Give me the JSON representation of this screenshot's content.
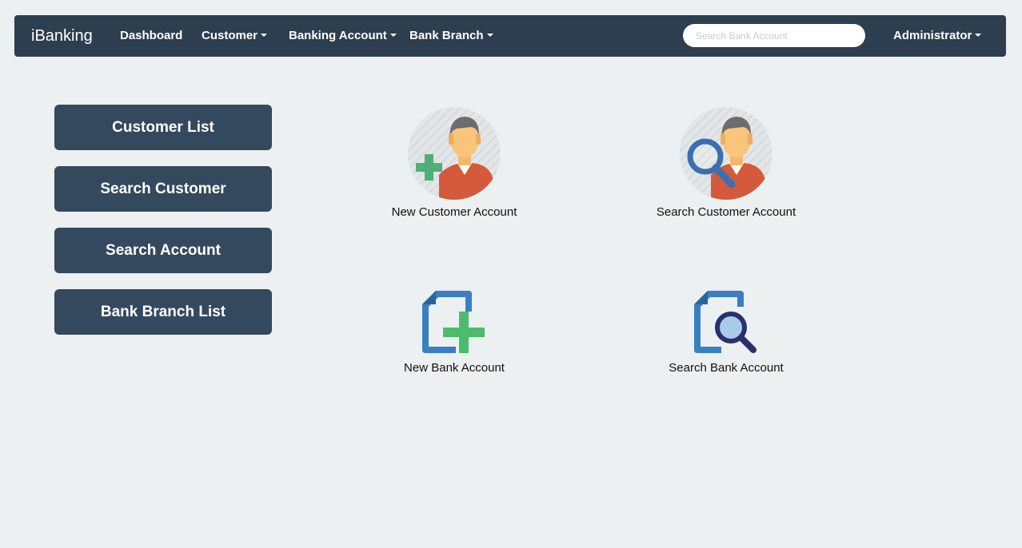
{
  "navbar": {
    "brand": "iBanking",
    "items": [
      {
        "label": "Dashboard",
        "dropdown": false
      },
      {
        "label": "Customer",
        "dropdown": true
      },
      {
        "label": "Banking Account",
        "dropdown": true
      },
      {
        "label": "Bank Branch",
        "dropdown": true
      }
    ],
    "search": {
      "placeholder": "Search Bank Account",
      "value": ""
    },
    "user": {
      "label": "Administrator",
      "dropdown": true
    }
  },
  "sidebar": {
    "buttons": [
      {
        "label": "Customer List"
      },
      {
        "label": "Search Customer"
      },
      {
        "label": "Search Account"
      },
      {
        "label": "Bank Branch List"
      }
    ]
  },
  "tiles": [
    {
      "label": "New Customer Account",
      "icon": "add-user-icon"
    },
    {
      "label": "Search Customer Account",
      "icon": "search-user-icon"
    },
    {
      "label": "New Bank Account",
      "icon": "add-document-icon"
    },
    {
      "label": "Search Bank Account",
      "icon": "search-document-icon"
    }
  ],
  "colors": {
    "navbar_bg": "#2c3e50",
    "sidebar_button_bg": "#34495e",
    "page_bg": "#ecf0f1",
    "accent_green": "#4cbb6c",
    "accent_blue": "#3a7fc1"
  }
}
